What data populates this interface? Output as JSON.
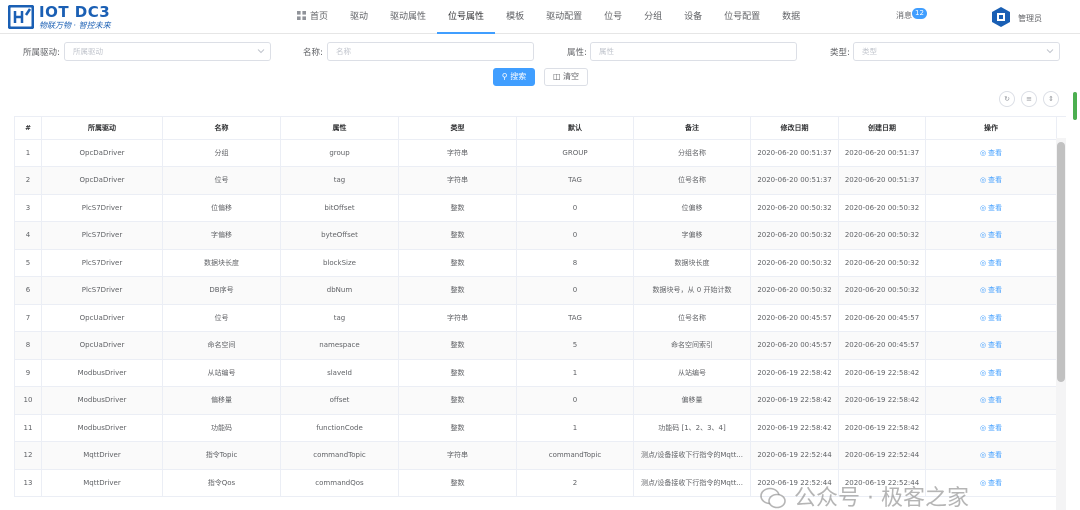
{
  "header": {
    "logo_title": "IOT DC3",
    "logo_subtitle": "物联万物 · 智控未来",
    "nav": [
      {
        "label": "首页",
        "icon": "home-icon"
      },
      {
        "label": "驱动"
      },
      {
        "label": "驱动属性"
      },
      {
        "label": "位号属性",
        "active": true
      },
      {
        "label": "模板"
      },
      {
        "label": "驱动配置"
      },
      {
        "label": "位号"
      },
      {
        "label": "分组"
      },
      {
        "label": "设备"
      },
      {
        "label": "位号配置"
      },
      {
        "label": "数据"
      }
    ],
    "notice_label": "消息",
    "notice_count": "12",
    "admin_label": "管理员"
  },
  "search": {
    "driver_label": "所属驱动:",
    "driver_placeholder": "所属驱动",
    "name_label": "名称:",
    "name_placeholder": "名称",
    "attr_label": "属性:",
    "attr_placeholder": "属性",
    "type_label": "类型:",
    "type_placeholder": "类型",
    "search_button": "搜索",
    "clear_button": "清空"
  },
  "table": {
    "columns": [
      "#",
      "所属驱动",
      "名称",
      "属性",
      "类型",
      "默认",
      "备注",
      "修改日期",
      "创建日期",
      "操作"
    ],
    "view_label": "查看",
    "rows": [
      [
        "1",
        "OpcDaDriver",
        "分组",
        "group",
        "字符串",
        "GROUP",
        "分组名称",
        "2020-06-20 00:51:37",
        "2020-06-20 00:51:37"
      ],
      [
        "2",
        "OpcDaDriver",
        "位号",
        "tag",
        "字符串",
        "TAG",
        "位号名称",
        "2020-06-20 00:51:37",
        "2020-06-20 00:51:37"
      ],
      [
        "3",
        "PlcS7Driver",
        "位偏移",
        "bitOffset",
        "整数",
        "0",
        "位偏移",
        "2020-06-20 00:50:32",
        "2020-06-20 00:50:32"
      ],
      [
        "4",
        "PlcS7Driver",
        "字偏移",
        "byteOffset",
        "整数",
        "0",
        "字偏移",
        "2020-06-20 00:50:32",
        "2020-06-20 00:50:32"
      ],
      [
        "5",
        "PlcS7Driver",
        "数据块长度",
        "blockSize",
        "整数",
        "8",
        "数据块长度",
        "2020-06-20 00:50:32",
        "2020-06-20 00:50:32"
      ],
      [
        "6",
        "PlcS7Driver",
        "DB序号",
        "dbNum",
        "整数",
        "0",
        "数据块号，从 0 开始计数",
        "2020-06-20 00:50:32",
        "2020-06-20 00:50:32"
      ],
      [
        "7",
        "OpcUaDriver",
        "位号",
        "tag",
        "字符串",
        "TAG",
        "位号名称",
        "2020-06-20 00:45:57",
        "2020-06-20 00:45:57"
      ],
      [
        "8",
        "OpcUaDriver",
        "命名空间",
        "namespace",
        "整数",
        "5",
        "命名空间索引",
        "2020-06-20 00:45:57",
        "2020-06-20 00:45:57"
      ],
      [
        "9",
        "ModbusDriver",
        "从站编号",
        "slaveId",
        "整数",
        "1",
        "从站编号",
        "2020-06-19 22:58:42",
        "2020-06-19 22:58:42"
      ],
      [
        "10",
        "ModbusDriver",
        "偏移量",
        "offset",
        "整数",
        "0",
        "偏移量",
        "2020-06-19 22:58:42",
        "2020-06-19 22:58:42"
      ],
      [
        "11",
        "ModbusDriver",
        "功能码",
        "functionCode",
        "整数",
        "1",
        "功能码 [1、2、3、4]",
        "2020-06-19 22:58:42",
        "2020-06-19 22:58:42"
      ],
      [
        "12",
        "MqttDriver",
        "指令Topic",
        "commandTopic",
        "字符串",
        "commandTopic",
        "测点/设备接收下行指令的Mqtt...",
        "2020-06-19 22:52:44",
        "2020-06-19 22:52:44"
      ],
      [
        "13",
        "MqttDriver",
        "指令Qos",
        "commandQos",
        "整数",
        "2",
        "测点/设备接收下行指令的Mqtt...",
        "2020-06-19 22:52:44",
        "2020-06-19 22:52:44"
      ]
    ]
  },
  "watermark": "公众号 · 极客之家",
  "colors": {
    "primary": "#409eff",
    "logo": "#1a5fb4",
    "border": "#ebeef5"
  }
}
